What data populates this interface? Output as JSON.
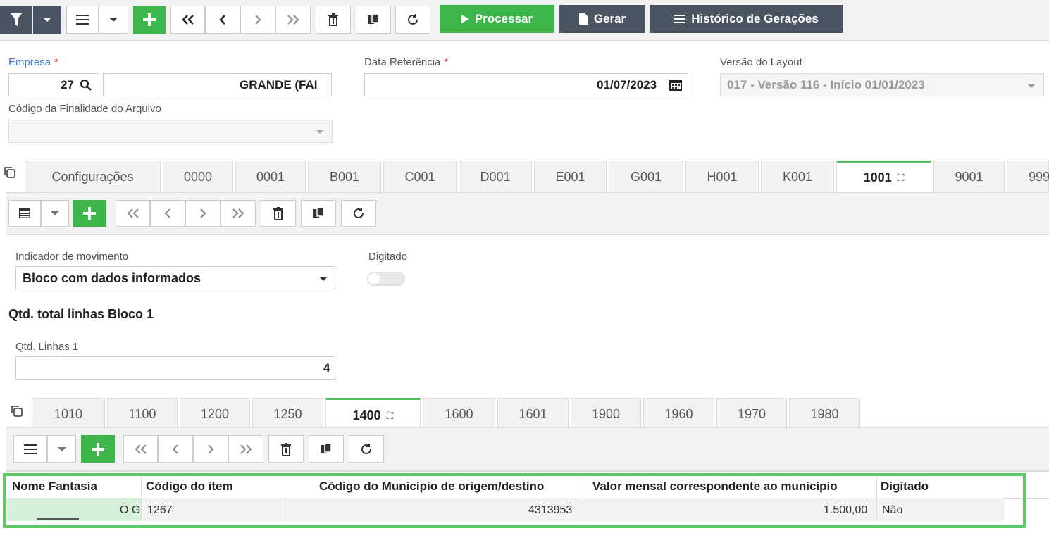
{
  "toolbar": {
    "process_label": "Processar",
    "generate_label": "Gerar",
    "history_label": "Histórico de Gerações"
  },
  "form": {
    "empresa_label": "Empresa",
    "empresa_code": "27",
    "empresa_name": "GRANDE (FAI",
    "data_ref_label": "Data Referência",
    "data_ref_value": "01/07/2023",
    "layout_label": "Versão do Layout",
    "layout_value": "017 - Versão 116 - Início 01/01/2023",
    "finalidade_label": "Código da Finalidade do Arquivo",
    "required_mark": "*"
  },
  "tabs_main": [
    "Configurações",
    "0000",
    "0001",
    "B001",
    "C001",
    "D001",
    "E001",
    "G001",
    "H001",
    "K001",
    "1001",
    "9001",
    "999"
  ],
  "bloco": {
    "indicador_label": "Indicador de movimento",
    "indicador_value": "Bloco com dados informados",
    "digitado_label": "Digitado",
    "section_title": "Qtd. total linhas Bloco 1",
    "qtd_label": "Qtd. Linhas 1",
    "qtd_value": "4"
  },
  "tabs_sub": [
    "1010",
    "1100",
    "1200",
    "1250",
    "1400",
    "1600",
    "1601",
    "1900",
    "1960",
    "1970",
    "1980"
  ],
  "grid": {
    "columns": [
      "Nome Fantasia",
      "Código do item",
      "Código do Município de origem/destino",
      "Valor mensal correspondente ao município",
      "Digitado"
    ],
    "rows": [
      {
        "nome": "O G",
        "codigo": "1267",
        "municipio": "4313953",
        "valor": "1.500,00",
        "digitado": "Não"
      }
    ]
  },
  "colors": {
    "green": "#3cb54a",
    "dark": "#4a5561",
    "accent_blue": "#3a7ad6",
    "required": "#e03c31"
  }
}
